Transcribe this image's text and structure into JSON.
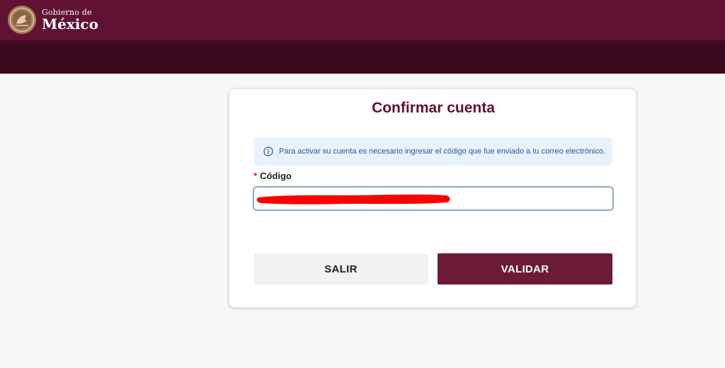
{
  "header": {
    "logo_line1": "Gobierno de",
    "logo_line2": "México",
    "icon": "seal-icon"
  },
  "colors": {
    "brand": "#611232",
    "brand_dark": "#3b0a1f",
    "info_bg": "#e9f2fc",
    "info_text": "#1f5f8b",
    "required": "#d32f2f",
    "redaction": "#ff0000"
  },
  "card": {
    "title": "Confirmar cuenta",
    "info_icon": "info-icon",
    "info_text": "Para activar su cuenta es necesario ingresar el código que fue enviado a tu correo electrónico.",
    "field_required_mark": "*",
    "field_label": "Código",
    "field_value": "",
    "cancel_label": "SALIR",
    "submit_label": "VALIDAR"
  }
}
